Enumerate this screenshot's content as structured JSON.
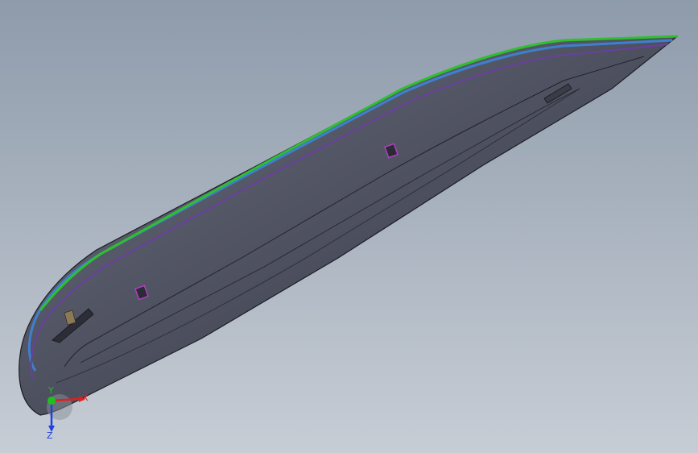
{
  "colors": {
    "background_top": "#8e9bab",
    "background_bottom": "#c7cdd5",
    "part_body": "#4a4d5c",
    "part_body_light": "#6a6d7c",
    "edge_green": "#2fbf2f",
    "edge_blue": "#3f7fd0",
    "edge_purple": "#6a3fa0",
    "feature_magenta": "#b03fc0",
    "axis_x": "#e02020",
    "axis_y": "#20c020",
    "axis_z": "#2040e0"
  },
  "triad": {
    "x_label": "X",
    "y_label": "Y",
    "z_label": "Z",
    "icon": "coordinate-triad-icon"
  }
}
